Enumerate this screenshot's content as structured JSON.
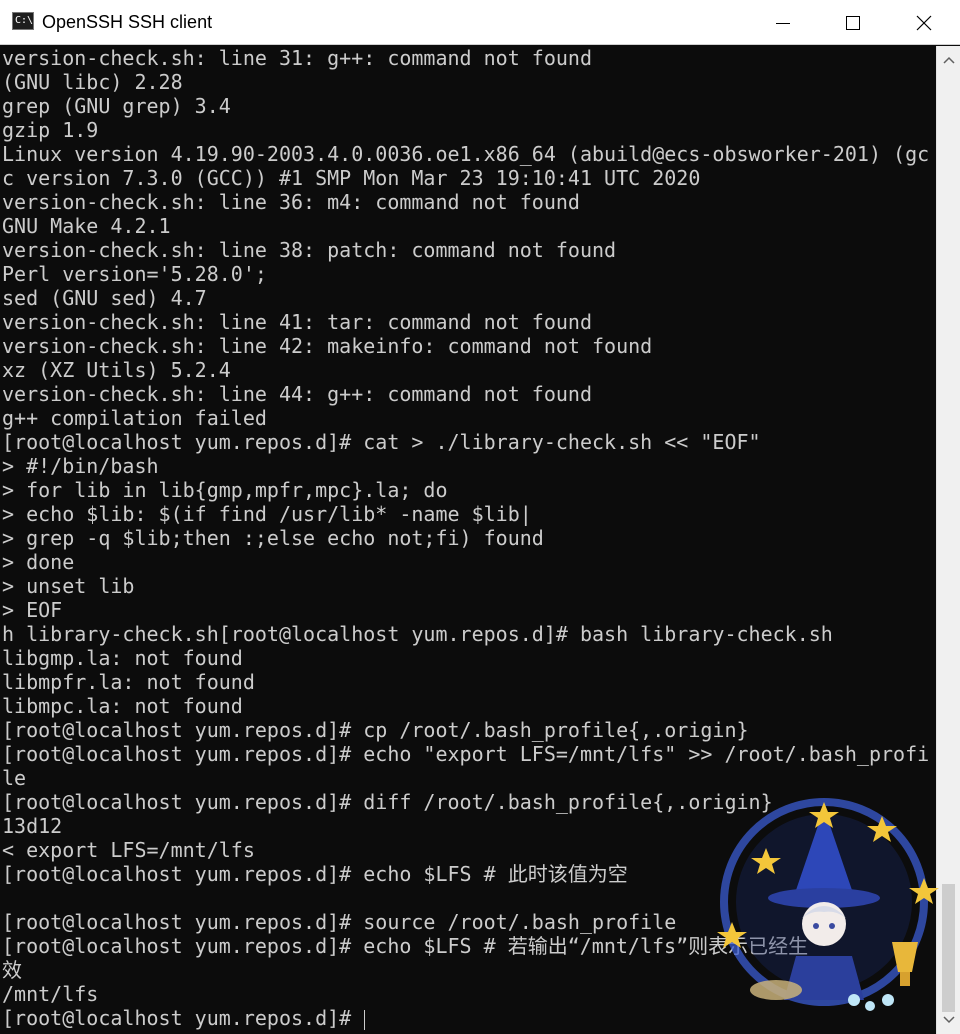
{
  "window": {
    "title": "OpenSSH SSH client",
    "icon_text": "C:\\",
    "controls": [
      "minimize-icon",
      "maximize-icon",
      "close-icon"
    ]
  },
  "terminal": {
    "lines": [
      "version-check.sh: line 31: g++: command not found",
      "(GNU libc) 2.28",
      "grep (GNU grep) 3.4",
      "gzip 1.9",
      "Linux version 4.19.90-2003.4.0.0036.oe1.x86_64 (abuild@ecs-obsworker-201) (gc",
      "c version 7.3.0 (GCC)) #1 SMP Mon Mar 23 19:10:41 UTC 2020",
      "version-check.sh: line 36: m4: command not found",
      "GNU Make 4.2.1",
      "version-check.sh: line 38: patch: command not found",
      "Perl version='5.28.0';",
      "sed (GNU sed) 4.7",
      "version-check.sh: line 41: tar: command not found",
      "version-check.sh: line 42: makeinfo: command not found",
      "xz (XZ Utils) 5.2.4",
      "version-check.sh: line 44: g++: command not found",
      "g++ compilation failed",
      "[root@localhost yum.repos.d]# cat > ./library-check.sh << \"EOF\"",
      "> #!/bin/bash",
      "> for lib in lib{gmp,mpfr,mpc}.la; do",
      "> echo $lib: $(if find /usr/lib* -name $lib|",
      "> grep -q $lib;then :;else echo not;fi) found",
      "> done",
      "> unset lib",
      "> EOF",
      "h library-check.sh[root@localhost yum.repos.d]# bash library-check.sh",
      "libgmp.la: not found",
      "libmpfr.la: not found",
      "libmpc.la: not found",
      "[root@localhost yum.repos.d]# cp /root/.bash_profile{,.origin}",
      "[root@localhost yum.repos.d]# echo \"export LFS=/mnt/lfs\" >> /root/.bash_profi",
      "le",
      "[root@localhost yum.repos.d]# diff /root/.bash_profile{,.origin}",
      "13d12",
      "< export LFS=/mnt/lfs",
      "[root@localhost yum.repos.d]# echo $LFS # 此时该值为空",
      "",
      "[root@localhost yum.repos.d]# source /root/.bash_profile",
      "[root@localhost yum.repos.d]# echo $LFS # 若输出“/mnt/lfs”则表示已经生",
      "效",
      "/mnt/lfs",
      "[root@localhost yum.repos.d]# "
    ]
  },
  "colors": {
    "terminal_bg": "#0c0c0c",
    "terminal_fg": "#cccccc",
    "titlebar_bg": "#ffffff",
    "scrollbar_bg": "#f0f0f0",
    "scrollbar_thumb": "#cdcdcd"
  },
  "icons": [
    "up-arrow-icon",
    "down-arrow-icon",
    "wizard-sticker"
  ]
}
